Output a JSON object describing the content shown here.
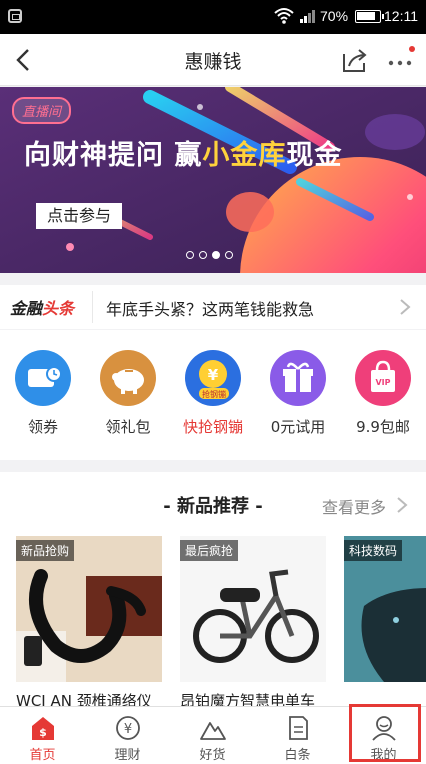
{
  "status_bar": {
    "battery": "70%",
    "time": "12:11"
  },
  "nav": {
    "title": "惠赚钱"
  },
  "banner": {
    "tag": "直播间",
    "headline_a": "向财神提问 赢",
    "headline_b": "小金库",
    "headline_c": "现金",
    "cta": "点击参与",
    "page_count": 4,
    "active_page": 2
  },
  "news": {
    "brand_a": "金融",
    "brand_b": "头条",
    "headline": "年底手头紧？这两笔钱能救急"
  },
  "quick_entries": [
    {
      "label": "领券",
      "icon": "coupon-icon",
      "color": "#2f8fe8"
    },
    {
      "label": "领礼包",
      "icon": "piggy-bank-icon",
      "color": "#d8913f"
    },
    {
      "label": "快抢钢镚",
      "icon": "yen-coin-icon",
      "color": "#2b6fe0",
      "badge": "抢钢镚",
      "hot": true
    },
    {
      "label": "0元试用",
      "icon": "gift-icon",
      "color": "#8a5be8"
    },
    {
      "label": "9.9包邮",
      "icon": "shopping-bag-icon",
      "color": "#ef3f7a",
      "badge": "VIP"
    }
  ],
  "products": {
    "title": "- 新品推荐 -",
    "see_more": "查看更多",
    "items": [
      {
        "badge": "新品抢购",
        "name": "WCI AN 颈椎通络仪"
      },
      {
        "badge": "最后疯抢",
        "name": "昂铂魔方智慧电单车"
      },
      {
        "badge": "科技数码",
        "name": ""
      }
    ]
  },
  "tabs": [
    {
      "label": "首页",
      "icon": "home-icon",
      "active": true
    },
    {
      "label": "理财",
      "icon": "yen-icon"
    },
    {
      "label": "好货",
      "icon": "mountain-icon"
    },
    {
      "label": "白条",
      "icon": "note-icon"
    },
    {
      "label": "我的",
      "icon": "profile-icon"
    }
  ],
  "colors": {
    "accent": "#e53935",
    "banner_bg": "#4a2a62"
  }
}
